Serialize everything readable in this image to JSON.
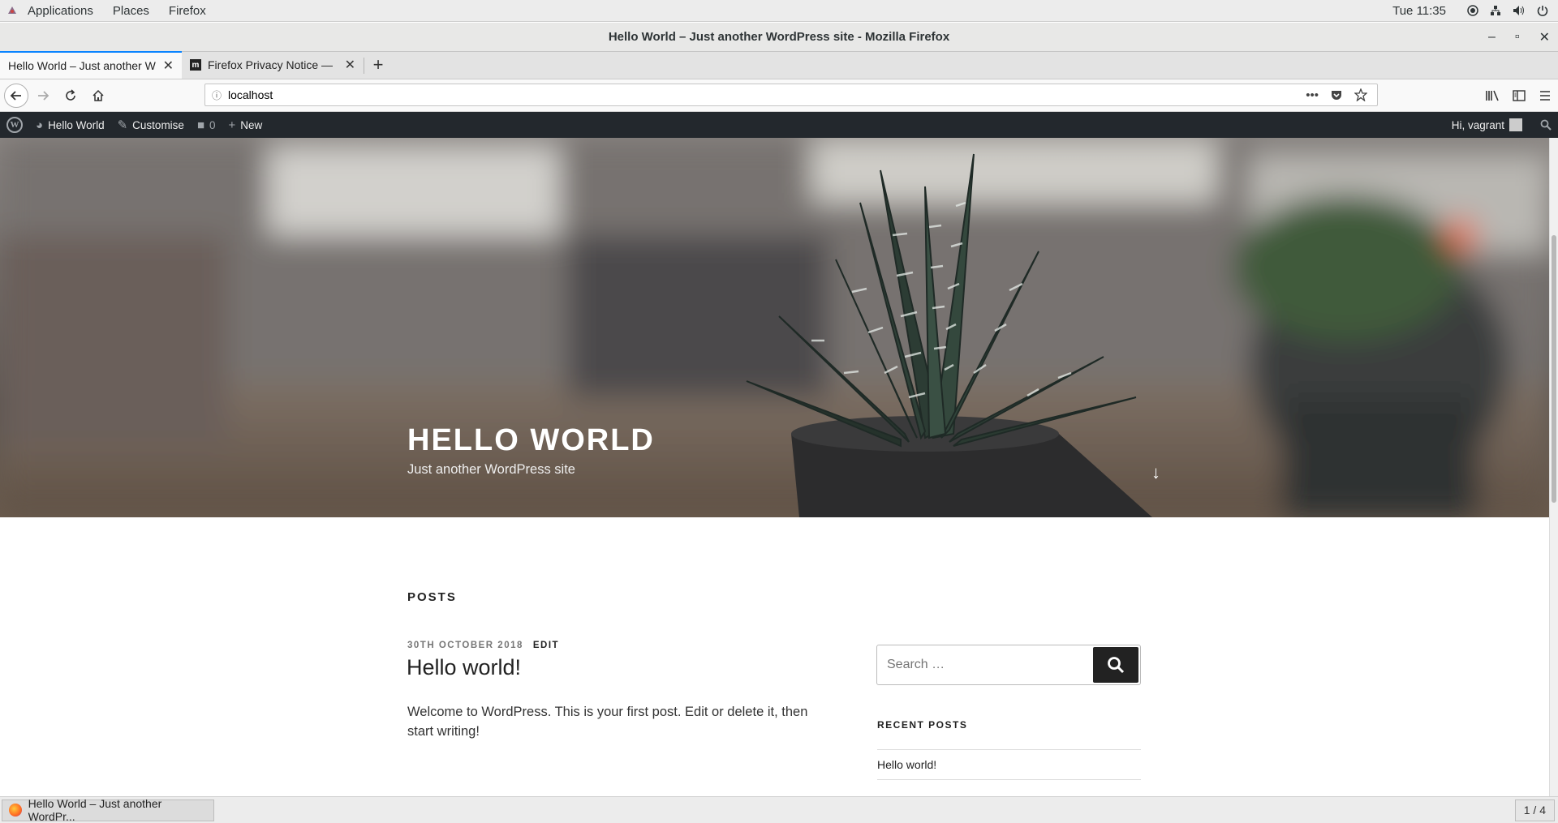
{
  "desktop": {
    "menu": [
      "Applications",
      "Places",
      "Firefox"
    ],
    "clock": "Tue 11:35"
  },
  "window": {
    "title": "Hello World – Just another WordPress site - Mozilla Firefox",
    "controls": {
      "minimize": "–",
      "maximize": "▫",
      "close": "✕"
    }
  },
  "tabs": [
    {
      "label": "Hello World – Just another W",
      "active": true
    },
    {
      "label": "Firefox Privacy Notice —",
      "active": false,
      "favicon": "m"
    }
  ],
  "browser": {
    "url": "localhost"
  },
  "wp_adminbar": {
    "site_name": "Hello World",
    "customise": "Customise",
    "comments_count": "0",
    "new": "New",
    "greeting": "Hi, vagrant"
  },
  "site": {
    "title": "HELLO WORLD",
    "description": "Just another WordPress site"
  },
  "content": {
    "section_heading": "POSTS",
    "post": {
      "date": "30TH OCTOBER 2018",
      "edit": "EDIT",
      "title": "Hello world!",
      "excerpt": "Welcome to WordPress. This is your first post. Edit or delete it, then start writing!"
    }
  },
  "sidebar": {
    "search_placeholder": "Search …",
    "recent_heading": "RECENT POSTS",
    "recent_posts": [
      "Hello world!"
    ]
  },
  "taskbar": {
    "task_label": "Hello World – Just another WordPr...",
    "pager": "1 / 4"
  }
}
